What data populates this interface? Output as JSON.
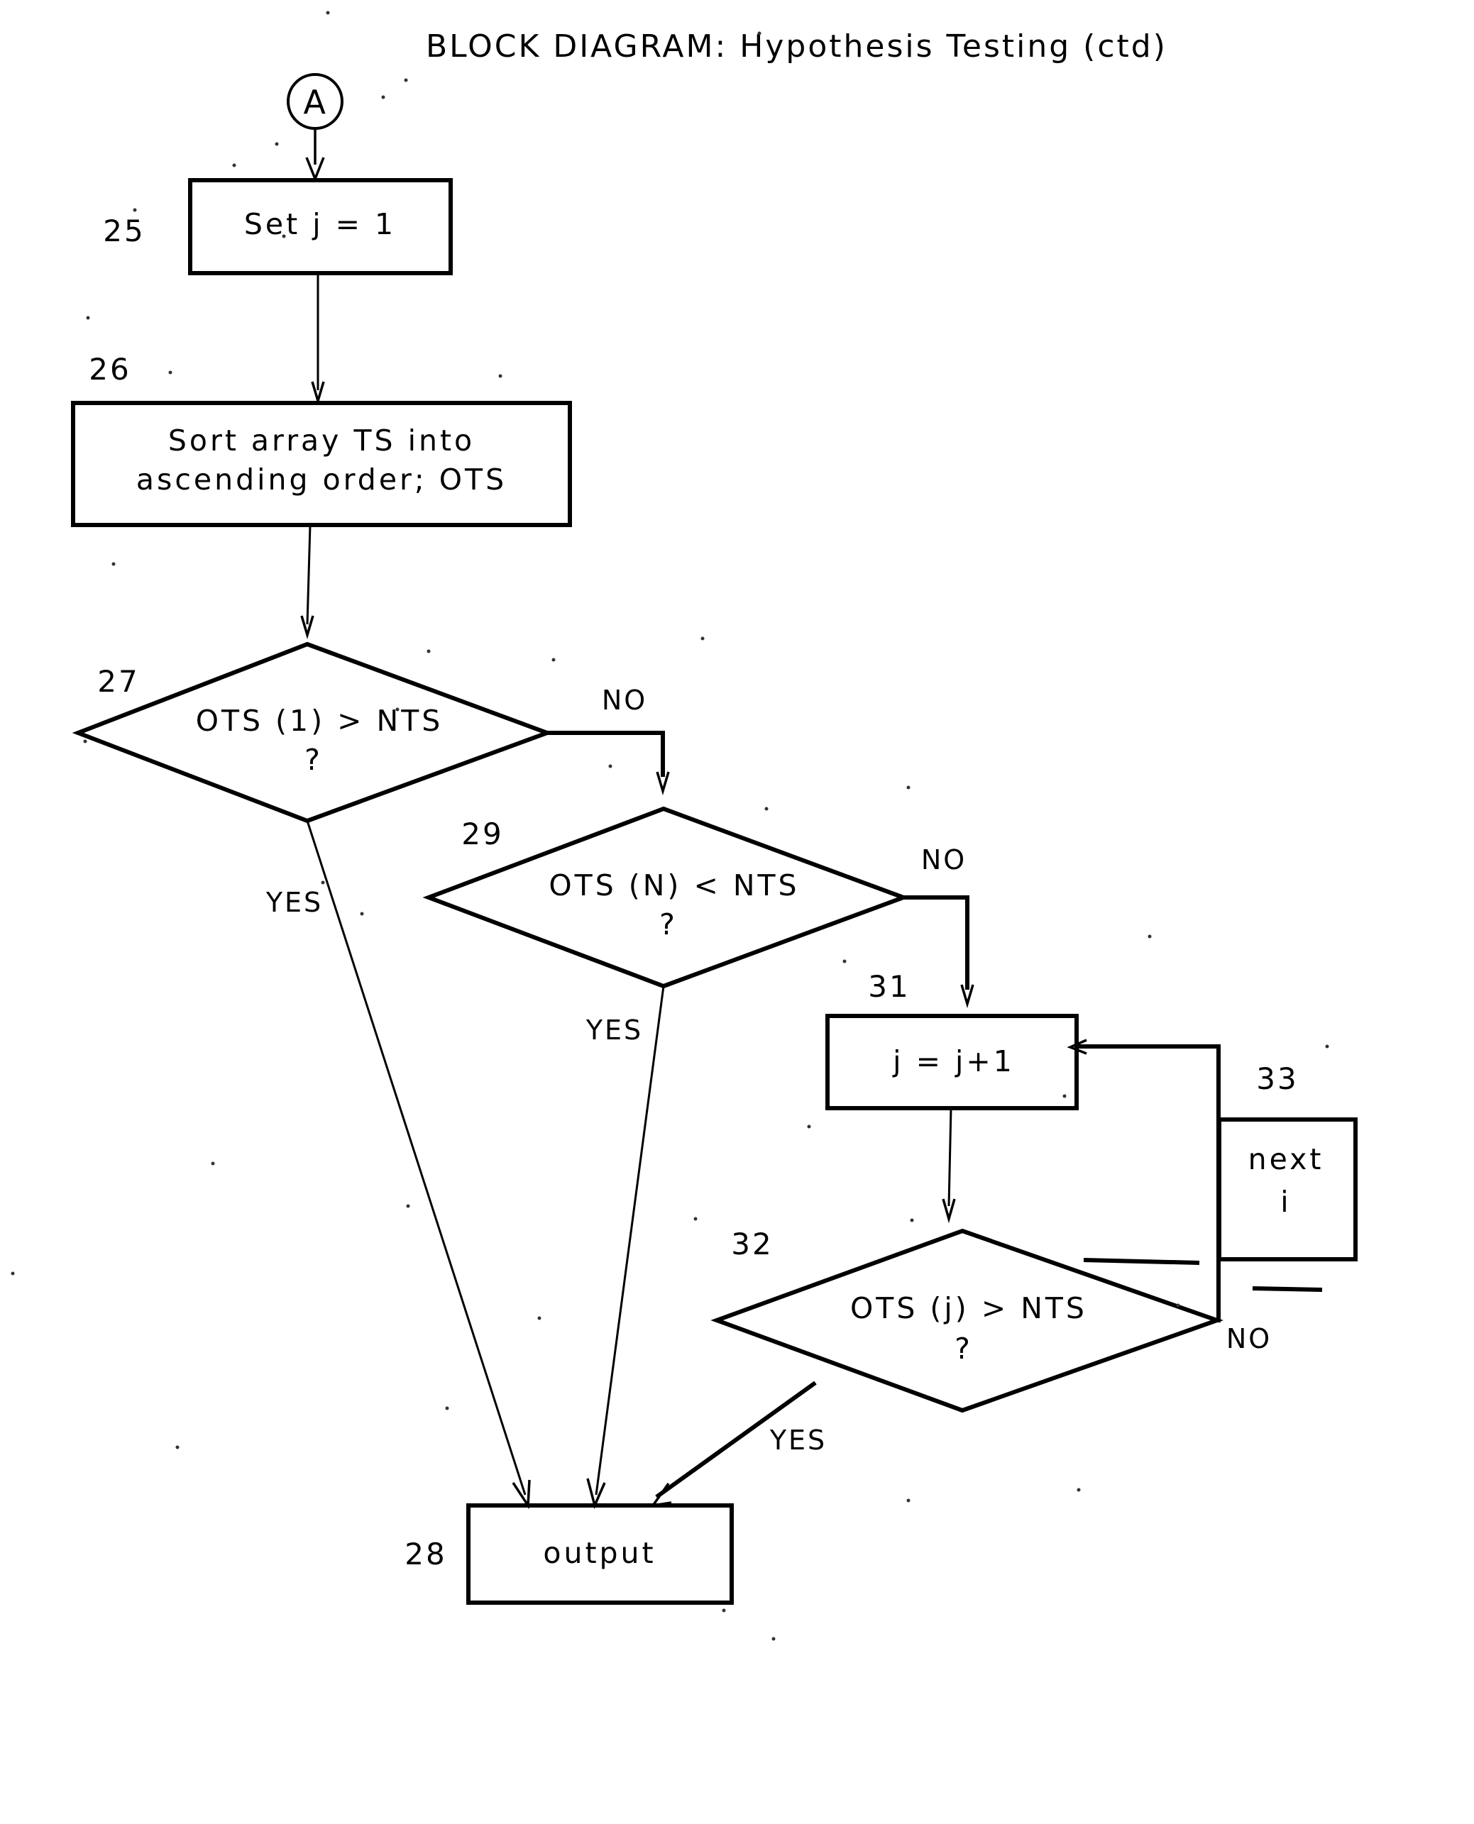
{
  "title": "BLOCK DIAGRAM: Hypothesis Testing (ctd)",
  "connector": {
    "label": "A"
  },
  "nodes": {
    "n25": {
      "ref": "25",
      "text": "Set j = 1",
      "shape": "process"
    },
    "n26": {
      "ref": "26",
      "line1": "Sort array TS into",
      "line2": "ascending order; OTS",
      "shape": "process"
    },
    "n27": {
      "ref": "27",
      "text": "OTS (1) > NTS",
      "question": "?",
      "shape": "decision"
    },
    "n29": {
      "ref": "29",
      "text": "OTS (N) < NTS",
      "question": "?",
      "shape": "decision"
    },
    "n31": {
      "ref": "31",
      "text": "j = j+1",
      "shape": "process"
    },
    "n32": {
      "ref": "32",
      "text": "OTS (j) > NTS",
      "question": "?",
      "shape": "decision"
    },
    "n33": {
      "ref": "33",
      "line1": "next",
      "line2": "i",
      "shape": "process"
    },
    "n28": {
      "ref": "28",
      "text": "output",
      "shape": "process"
    }
  },
  "edges": {
    "e27_no": "NO",
    "e27_yes": "YES",
    "e29_no": "NO",
    "e29_yes": "YES",
    "e32_no": "NO",
    "e32_yes": "YES"
  },
  "colors": {
    "ink": "#000000",
    "paper": "#ffffff"
  }
}
